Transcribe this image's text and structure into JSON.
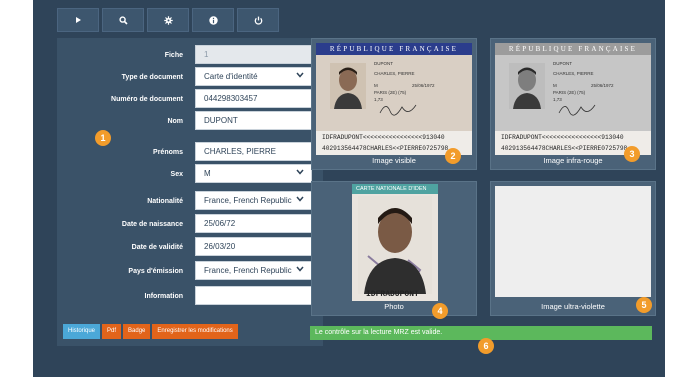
{
  "toolbar": {
    "buttons": [
      {
        "icon": "play-icon"
      },
      {
        "icon": "search-icon"
      },
      {
        "icon": "gear-icon"
      },
      {
        "icon": "info-icon"
      },
      {
        "icon": "power-icon"
      }
    ]
  },
  "form": {
    "fiche": {
      "label": "Fiche",
      "value": "1"
    },
    "type_document": {
      "label": "Type de document",
      "value": "Carte d'identité"
    },
    "numero_document": {
      "label": "Numéro de document",
      "value": "044298303457"
    },
    "nom": {
      "label": "Nom",
      "value": "DUPONT"
    },
    "prenoms": {
      "label": "Prénoms",
      "value": "CHARLES, PIERRE"
    },
    "sex": {
      "label": "Sex",
      "value": "M"
    },
    "nationalite": {
      "label": "Nationalité",
      "value": "France, French Republic"
    },
    "date_naissance": {
      "label": "Date de naissance",
      "value": "25/06/72"
    },
    "date_validite": {
      "label": "Date de validité",
      "value": "26/03/20"
    },
    "pays_emission": {
      "label": "Pays d'émission",
      "value": "France, French Republic"
    },
    "information": {
      "label": "Information",
      "value": ""
    }
  },
  "actions": {
    "historique": "Historique",
    "pdf": "Pdf",
    "badge": "Badge",
    "save": "Enregistrer les modifications"
  },
  "images": {
    "visible_caption": "Image visible",
    "infrared_caption": "Image infra-rouge",
    "photo_caption": "Photo",
    "uv_caption": "Image ultra-violette"
  },
  "card": {
    "header": "RÉPUBLIQUE FRANÇAISE",
    "nom_line": "DUPONT",
    "prenoms_line": "CHARLES, PIERRE",
    "sexe_line": "M",
    "birth_line": "25/06/1972",
    "city_line": "PARIS (2E) (75)",
    "height_line": "1,73",
    "mrz_line1": "IDFRADUPONT<<<<<<<<<<<<<<<<913040",
    "mrz_line2": "402913564478CHARLES<<PIERRE0725798",
    "photo_header": "CARTE NATIONALE D'IDEN",
    "photo_mrz": "IDFRADUPONT"
  },
  "badges": [
    "1",
    "2",
    "3",
    "4",
    "5",
    "6"
  ],
  "status": {
    "message": "Le contrôle sur la lecture MRZ est valide.",
    "color": "#5cb85c"
  },
  "colors": {
    "background": "#2f4459",
    "panel": "#3a5268",
    "accent_orange": "#e2641a",
    "accent_blue": "#4ba8d8",
    "badge": "#f29c2b"
  }
}
